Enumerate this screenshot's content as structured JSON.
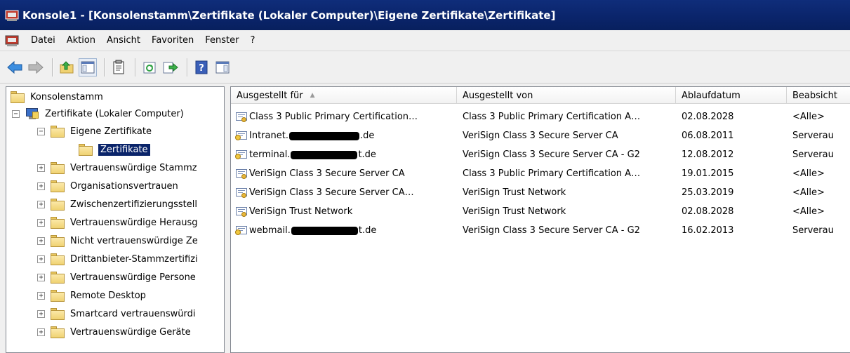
{
  "window": {
    "title": "Konsole1 - [Konsolenstamm\\Zertifikate (Lokaler Computer)\\Eigene Zertifikate\\Zertifikate]"
  },
  "menu": {
    "items": [
      "Datei",
      "Aktion",
      "Ansicht",
      "Favoriten",
      "Fenster",
      "?"
    ]
  },
  "toolbar": {
    "buttons": [
      "back-arrow-icon",
      "forward-arrow-icon",
      "up-folder-icon",
      "show-hide-tree-icon",
      "properties-icon",
      "refresh-icon",
      "export-list-icon",
      "help-icon",
      "show-hide-action-pane-icon"
    ]
  },
  "tree": {
    "root": "Konsolenstamm",
    "computer": "Zertifikate (Lokaler Computer)",
    "personal": "Eigene Zertifikate",
    "selected": "Zertifikate",
    "items": [
      "Vertrauenswürdige Stammz",
      "Organisationsvertrauen",
      "Zwischenzertifizierungsstell",
      "Vertrauenswürdige Herausg",
      "Nicht vertrauenswürdige Ze",
      "Drittanbieter-Stammzertifizi",
      "Vertrauenswürdige Persone",
      "Remote Desktop",
      "Smartcard vertrauenswürdi",
      "Vertrauenswürdige Geräte"
    ]
  },
  "list": {
    "columns": [
      "Ausgestellt für",
      "Ausgestellt von",
      "Ablaufdatum",
      "Beabsicht"
    ],
    "rows": [
      {
        "icon": "certificate-icon",
        "pre": "Class 3 Public Primary Certification…",
        "post": "",
        "issuer": "Class 3 Public Primary Certification A…",
        "expires": "02.08.2028",
        "purpose": "<Alle>"
      },
      {
        "icon": "certificate-key-icon",
        "pre": "Intranet.",
        "post": ".de",
        "issuer": "VeriSign Class 3 Secure Server CA",
        "expires": "06.08.2011",
        "purpose": "Serverau"
      },
      {
        "icon": "certificate-key-icon",
        "pre": "terminal.",
        "post": "t.de",
        "issuer": "VeriSign Class 3 Secure Server CA - G2",
        "expires": "12.08.2012",
        "purpose": "Serverau"
      },
      {
        "icon": "certificate-icon",
        "pre": "VeriSign Class 3 Secure Server CA",
        "post": "",
        "issuer": "Class 3 Public Primary Certification A…",
        "expires": "19.01.2015",
        "purpose": "<Alle>"
      },
      {
        "icon": "certificate-icon",
        "pre": "VeriSign Class 3 Secure Server CA…",
        "post": "",
        "issuer": "VeriSign Trust Network",
        "expires": "25.03.2019",
        "purpose": "<Alle>"
      },
      {
        "icon": "certificate-icon",
        "pre": "VeriSign Trust Network",
        "post": "",
        "issuer": "VeriSign Trust Network",
        "expires": "02.08.2028",
        "purpose": "<Alle>"
      },
      {
        "icon": "certificate-key-icon",
        "pre": "webmail.",
        "post": "t.de",
        "issuer": "VeriSign Class 3 Secure Server CA - G2",
        "expires": "16.02.2013",
        "purpose": "Serverau"
      }
    ]
  }
}
